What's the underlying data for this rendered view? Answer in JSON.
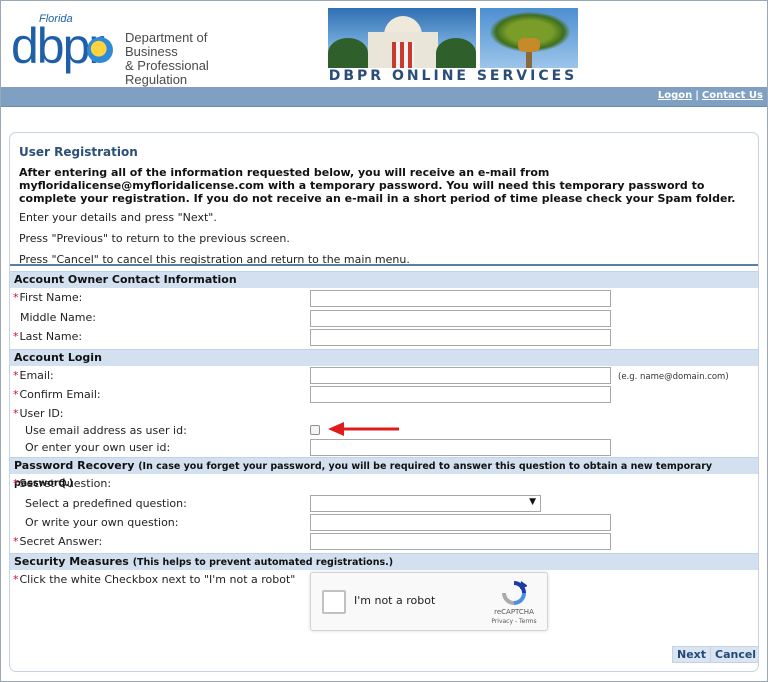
{
  "header": {
    "logo_florida": "Florida",
    "logo_text": "dbpr",
    "department_line1": "Department of Business",
    "department_line2": "& Professional Regulation",
    "banner_title": "DBPR  ONLINE SERVICES"
  },
  "nav": {
    "logon": "Logon",
    "separator": "|",
    "contact": "Contact Us"
  },
  "intro": {
    "title": "User Registration",
    "notice": "After entering all of the information requested below, you will receive an e-mail from myfloridalicense@myfloridalicense.com with a temporary password. You will need this temporary password to complete your registration. If you do not receive an e-mail in a short period of time please check your Spam folder.",
    "line1": "Enter your details and press \"Next\".",
    "line2": "Press \"Previous\" to return to the previous screen.",
    "line3": "Press \"Cancel\" to cancel this registration and return to the main menu."
  },
  "required_mark": "*",
  "contact_section": {
    "title": "Account Owner Contact Information",
    "first_name": "First Name:",
    "middle_name": "Middle Name:",
    "last_name": "Last Name:",
    "first_name_value": "",
    "middle_name_value": "",
    "last_name_value": ""
  },
  "login_section": {
    "title": "Account Login",
    "email": "Email:",
    "email_hint": "(e.g. name@domain.com)",
    "confirm_email": "Confirm Email:",
    "user_id": "User ID:",
    "use_email": "Use email address as user id:",
    "own_user_id": "Or enter your own user id:",
    "use_email_checked": false
  },
  "recovery_section": {
    "title": "Password Recovery",
    "subtitle": "(In case you forget your password, you will be required to answer this question to obtain a new temporary password.)",
    "secret_question": "Secret Question:",
    "predefined": "Select a predefined question:",
    "predefined_value": "",
    "write_own": "Or write your own question:",
    "secret_answer": "Secret Answer:"
  },
  "security_section": {
    "title": "Security Measures",
    "subtitle": "(This helps to prevent automated registrations.)",
    "instruction": "Click the white Checkbox next to \"I'm not a robot\"",
    "captcha_label": "I'm not a robot",
    "captcha_brand": "reCAPTCHA",
    "captcha_terms": "Privacy - Terms"
  },
  "buttons": {
    "next": "Next",
    "cancel": "Cancel"
  },
  "colors": {
    "nav_bar": "#7fa0c2",
    "section_header": "#d2e0f0",
    "required": "#c8102e",
    "annotation_arrow": "#e01b1b"
  }
}
